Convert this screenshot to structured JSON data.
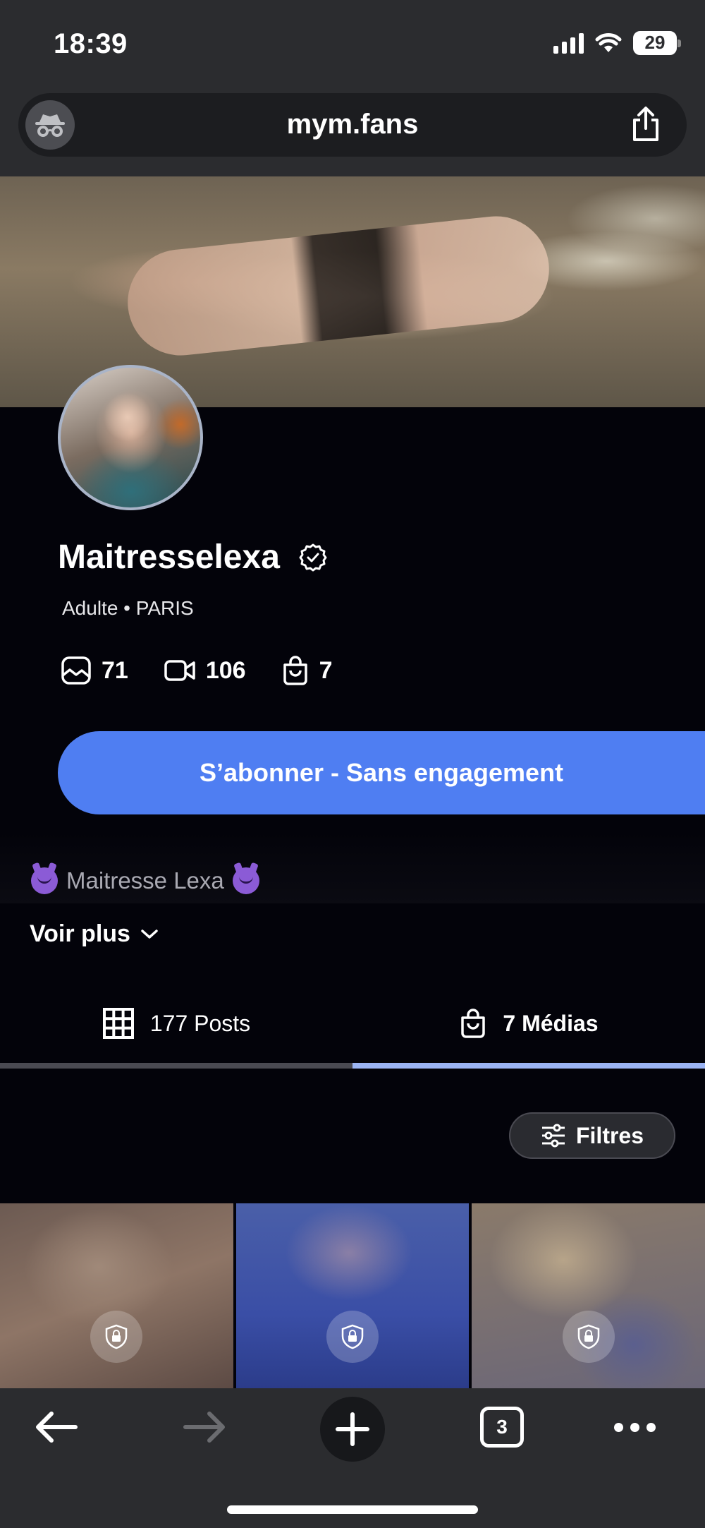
{
  "status_bar": {
    "time": "18:39",
    "battery": "29"
  },
  "browser": {
    "url": "mym.fans",
    "tabs_count": "3"
  },
  "profile": {
    "name": "Maitresselexa",
    "category": "Adulte • PARIS",
    "stats": {
      "photos": "71",
      "videos": "106",
      "medias": "7"
    },
    "subscribe_label": "S’abonner - Sans engagement",
    "bio": "Maitresse Lexa",
    "more_label": "Voir plus"
  },
  "tabs": [
    {
      "label": "177 Posts",
      "active": false
    },
    {
      "label": "7 Médias",
      "active": true
    }
  ],
  "filters_label": "Filtres",
  "media_tiles": [
    {
      "locked": true
    },
    {
      "locked": true
    },
    {
      "locked": true
    }
  ],
  "colors": {
    "accent": "#4f7ef2",
    "tab_indicator": "#9bb4f4",
    "background": "#03030a",
    "chrome": "#2b2c2f"
  },
  "icons": [
    "incognito-icon",
    "share-icon",
    "verified-icon",
    "photo-icon",
    "video-icon",
    "bag-icon",
    "grid-icon",
    "filter-icon",
    "lock-icon",
    "back-icon",
    "forward-icon",
    "plus-icon",
    "ellipsis-icon"
  ]
}
